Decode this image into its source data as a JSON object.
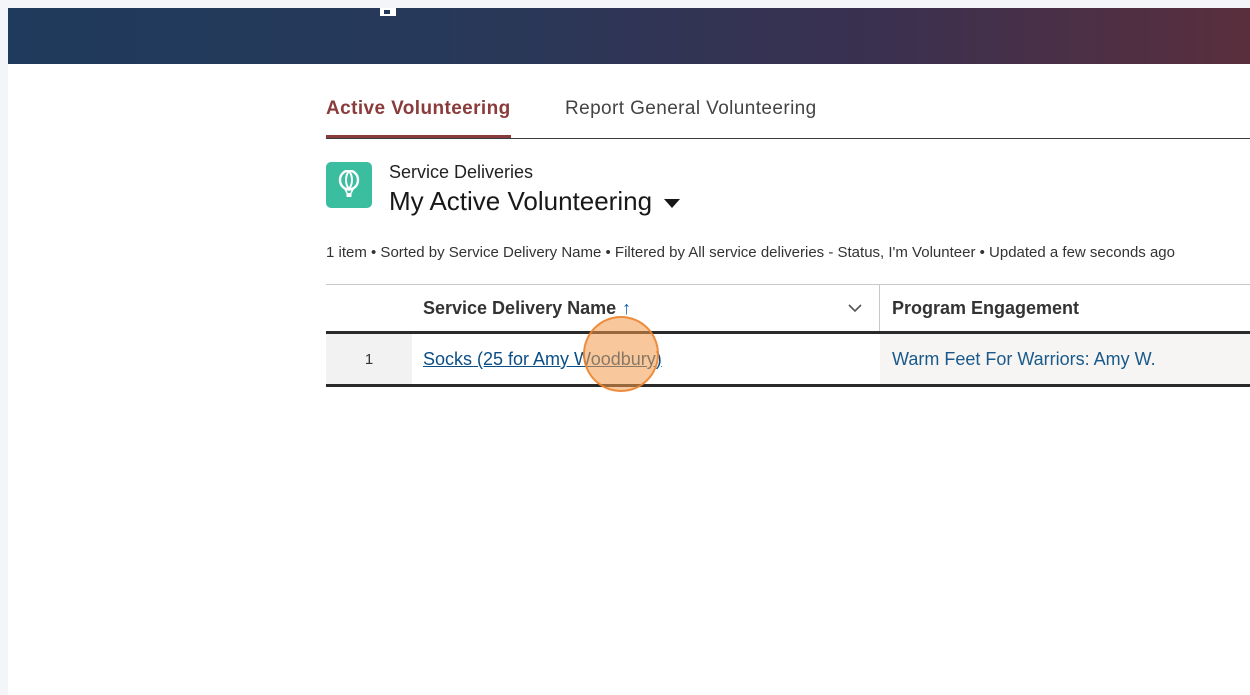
{
  "colors": {
    "tab_active": "#8a3b3b",
    "link": "#0b4e86",
    "icon_bg": "#3bbd9f",
    "click_indicator": "#f39b4b"
  },
  "header": {
    "glyph": "app-launcher-icon"
  },
  "tabs": [
    {
      "label": "Active Volunteering",
      "active": true
    },
    {
      "label": "Report General Volunteering",
      "active": false
    }
  ],
  "list_view": {
    "icon": "hot-air-balloon-icon",
    "object_name": "Service Deliveries",
    "title": "My Active Volunteering",
    "meta": "1 item • Sorted by Service Delivery Name • Filtered by All service deliveries - Status, I'm Volunteer • Updated a few seconds ago"
  },
  "table": {
    "columns": [
      {
        "label": "Service Delivery Name",
        "sort": "ascending"
      },
      {
        "label": "Program Engagement"
      }
    ],
    "sort_arrow": "↑",
    "rows": [
      {
        "number": "1",
        "service_delivery_name": "Socks (25 for Amy Woodbury)",
        "program_engagement": "Warm Feet For Warriors: Amy W."
      }
    ]
  }
}
